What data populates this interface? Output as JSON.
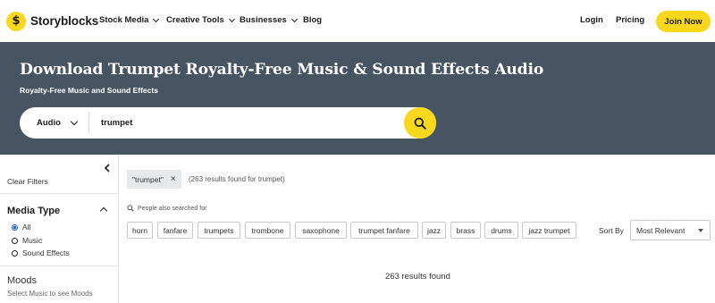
{
  "brand": {
    "logo_letter": "$",
    "name": "Storyblocks",
    "accent": "#f9d71c",
    "hero_bg": "#475563"
  },
  "nav": {
    "items": [
      {
        "label": "Stock Media",
        "has_dropdown": true
      },
      {
        "label": "Creative Tools",
        "has_dropdown": true
      },
      {
        "label": "Businesses",
        "has_dropdown": true
      },
      {
        "label": "Blog",
        "has_dropdown": false
      }
    ],
    "login": "Login",
    "pricing": "Pricing",
    "join": "Join Now"
  },
  "hero": {
    "title": "Download Trumpet Royalty-Free Music & Sound Effects Audio",
    "subtitle": "Royalty-Free Music and Sound Effects"
  },
  "search": {
    "type_label": "Audio",
    "query": "trumpet",
    "icon": "search-icon"
  },
  "sidebar": {
    "clear_filters": "Clear Filters",
    "media_type": {
      "title": "Media Type",
      "options": [
        {
          "label": "All",
          "selected": true
        },
        {
          "label": "Music",
          "selected": false
        },
        {
          "label": "Sound Effects",
          "selected": false
        }
      ]
    },
    "moods": {
      "title": "Moods",
      "subtitle": "Select Music to see Moods"
    }
  },
  "filters": {
    "active_chip": "\"trumpet\"",
    "remove_symbol": "×",
    "result_note": "(263 results found for trumpet)"
  },
  "related": {
    "label": "People also searched for",
    "tags": [
      "horn",
      "fanfare",
      "trumpets",
      "trombone",
      "saxophone",
      "trumpet fanfare",
      "jazz",
      "brass",
      "drums",
      "jazz trumpet"
    ]
  },
  "sort": {
    "label": "Sort By",
    "value": "Most Relevant"
  },
  "results": {
    "summary": "263 results found"
  }
}
